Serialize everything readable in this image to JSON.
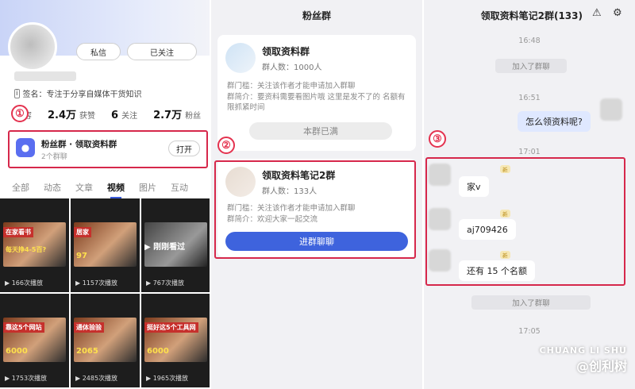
{
  "profile": {
    "dm_label": "私信",
    "follow_label": "已关注",
    "bio": "签名：专注于分享自媒体干货知识",
    "stats": [
      {
        "value": "内容",
        "num": ""
      },
      {
        "num": "2.4万",
        "label": "获赞"
      },
      {
        "num": "6",
        "label": "关注"
      },
      {
        "num": "2.7万",
        "label": "粉丝"
      }
    ],
    "group": {
      "title": "粉丝群 · 领取资料群",
      "sub": "2个群聊",
      "open_label": "打开"
    },
    "tabs": [
      "全部",
      "动态",
      "文章",
      "视频",
      "图片",
      "互动"
    ],
    "active_tab": "视频",
    "videos": [
      {
        "caption": "在家看书",
        "caption2": "每天挣4-5百?",
        "plays": "166次播放"
      },
      {
        "caption": "居家",
        "caption2": "97",
        "plays": "1157次播放"
      },
      {
        "caption": "",
        "caption2": "",
        "watched": "▶ 刚刚看过",
        "plays": "767次播放"
      },
      {
        "caption": "靠这5个网站",
        "caption2": "6000",
        "plays": "1753次播放"
      },
      {
        "caption": "通体验验",
        "caption2": "2065",
        "plays": "2485次播放"
      },
      {
        "caption": "挺好这5个工具网",
        "caption2": "6000",
        "plays": "1965次播放"
      }
    ]
  },
  "fan_groups": {
    "title": "粉丝群",
    "group1": {
      "name": "领取资料群",
      "count": "群人数：1000人",
      "threshold": "群门槛：关注该作者才能申请加入群聊",
      "intro": "群简介：要资料需要看图片哦 这里是发不了的 名额有限抓紧时间",
      "full_label": "本群已满"
    },
    "group2": {
      "name": "领取资料笔记2群",
      "count": "群人数：133人",
      "threshold": "群门槛：关注该作者才能申请加入群聊",
      "intro": "群简介：欢迎大家一起交流",
      "join_label": "进群聊聊"
    }
  },
  "chat": {
    "title": "领取资料笔记2群(133)",
    "times": [
      "16:48",
      "16:51",
      "17:01",
      "17:05"
    ],
    "sys_joined": "加入了群聊",
    "my_msg": "怎么领资料呢?",
    "tag": "新",
    "replies": [
      "家v",
      "aj709426",
      "还有 15 个名额"
    ]
  },
  "annotations": [
    "①",
    "②",
    "③"
  ],
  "watermark": {
    "top": "CHUANG LI SHU",
    "bottom": "@创利树"
  }
}
